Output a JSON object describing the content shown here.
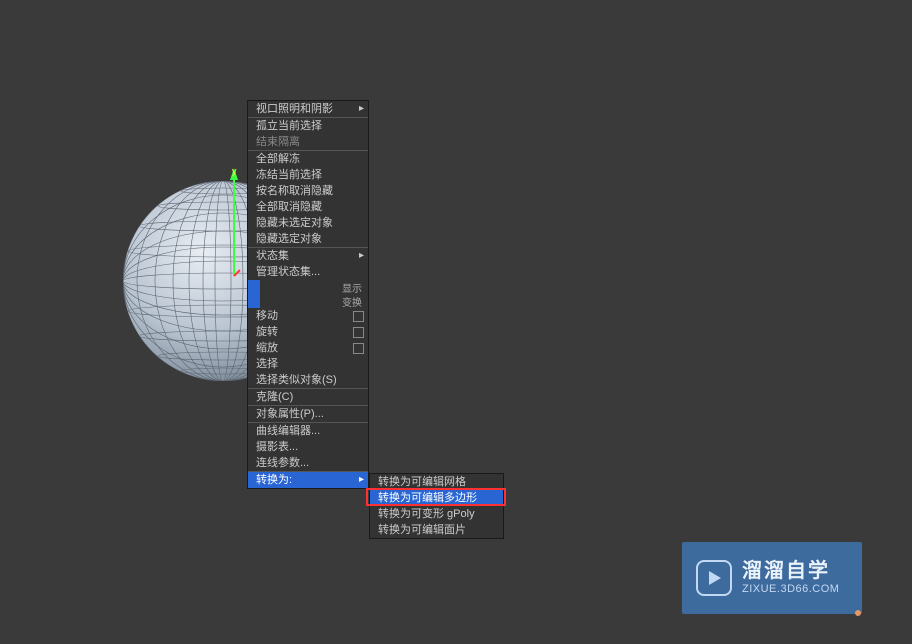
{
  "gizmo": {
    "axis_label": "y"
  },
  "menu": {
    "viewport_lighting": "视口照明和阴影",
    "isolate_selection": "孤立当前选择",
    "end_isolate": "结束隔离",
    "unfreeze_all": "全部解冻",
    "freeze_selection": "冻结当前选择",
    "unhide_by_name": "按名称取消隐藏",
    "unhide_all": "全部取消隐藏",
    "hide_unselected": "隐藏未选定对象",
    "hide_selected": "隐藏选定对象",
    "state_sets": "状态集",
    "manage_state_sets": "管理状态集...",
    "row_label_1": "显示",
    "row_label_2": "变换",
    "move": "移动",
    "rotate": "旋转",
    "scale": "缩放",
    "select": "选择",
    "select_similar": "选择类似对象(S)",
    "clone": "克隆(C)",
    "object_props": "对象属性(P)...",
    "curve_editor": "曲线编辑器...",
    "dopesheet": "摄影表...",
    "wire_params": "连线参数...",
    "convert_to": "转换为:"
  },
  "submenu": {
    "editable_mesh": "转换为可编辑网格",
    "editable_poly": "转换为可编辑多边形",
    "deformable_gpoly": "转换为可变形 gPoly",
    "editable_patch": "转换为可编辑面片"
  },
  "watermark": {
    "title": "溜溜自学",
    "sub": "ZIXUE.3D66.COM"
  }
}
